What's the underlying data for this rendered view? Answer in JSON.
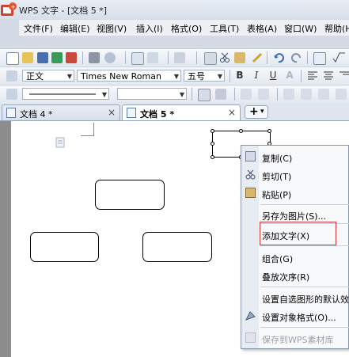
{
  "window": {
    "title": "WPS 文字 - [文档 5 *]"
  },
  "menu": [
    "文件(F)",
    "编辑(E)",
    "视图(V)",
    "插入(I)",
    "格式(O)",
    "工具(T)",
    "表格(A)",
    "窗口(W)",
    "帮助(H"
  ],
  "format_toolbar": {
    "style": "正文",
    "font": "Times New Roman",
    "size": "五号",
    "bold": "B",
    "italic": "I",
    "underline": "U",
    "font_color": "A"
  },
  "tabs": [
    {
      "label": "文档 4 *",
      "close": "×"
    },
    {
      "label": "文档 5 *",
      "close": "×"
    }
  ],
  "new_tab": {
    "plus": "+",
    "arrow": "▾"
  },
  "context_menu": {
    "copy": "复制(C)",
    "cut": "剪切(T)",
    "paste": "粘贴(P)",
    "save_as_image": "另存为图片(S)...",
    "add_text": "添加文字(X)",
    "group": "组合(G)",
    "order": "叠放次序(R)",
    "set_default": "设置自选图形的默认效果",
    "format_object": "设置对象格式(O)...",
    "save_to_library": "保存到WPS素材库"
  },
  "colors": {
    "highlight_border": "#cc3333",
    "menu_bg": "#f8f9fb",
    "page": "#ffffff"
  }
}
